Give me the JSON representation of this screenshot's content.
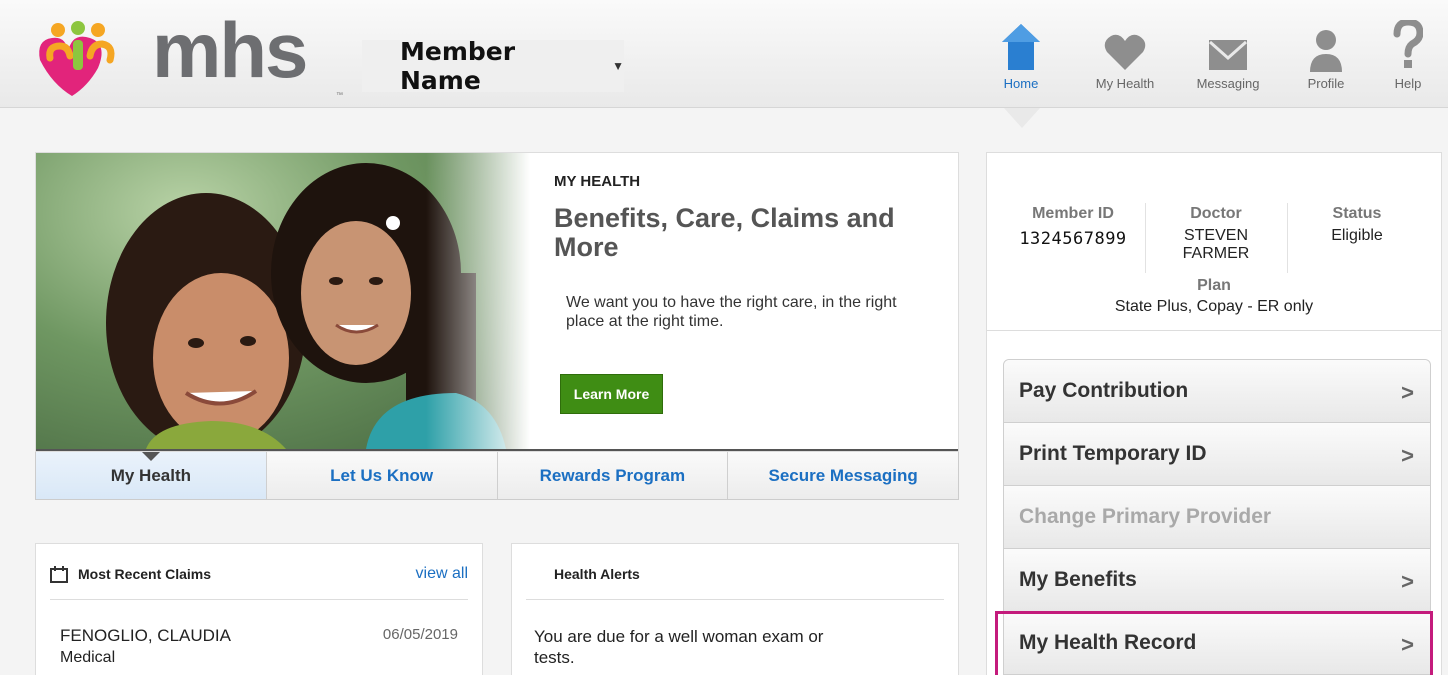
{
  "header": {
    "logo_text": "mhs",
    "member_name": "Member Name",
    "nav": [
      {
        "label": "Home",
        "icon": "home-icon"
      },
      {
        "label": "My Health",
        "icon": "heart-icon"
      },
      {
        "label": "Messaging",
        "icon": "envelope-icon"
      },
      {
        "label": "Profile",
        "icon": "person-icon"
      },
      {
        "label": "Help",
        "icon": "question-icon"
      }
    ]
  },
  "hero": {
    "eyebrow": "MY HEALTH",
    "title": "Benefits, Care, Claims and More",
    "body": "We want you to have the right care, in the right place at the right time.",
    "button": "Learn More"
  },
  "tabs": [
    "My Health",
    "Let Us Know",
    "Rewards Program",
    "Secure Messaging"
  ],
  "claims": {
    "title": "Most Recent Claims",
    "view_all": "view all",
    "items": [
      {
        "name": "FENOGLIO, CLAUDIA",
        "type": "Medical",
        "date": "06/05/2019"
      }
    ]
  },
  "alerts": {
    "title": "Health Alerts",
    "text": "You are due for a well woman exam or tests."
  },
  "member_info": {
    "member_id_label": "Member ID",
    "member_id": "1324567899",
    "doctor_label": "Doctor",
    "doctor_first": "STEVEN",
    "doctor_last": "FARMER",
    "status_label": "Status",
    "status": "Eligible",
    "plan_label": "Plan",
    "plan": "State Plus, Copay - ER only"
  },
  "actions": [
    {
      "label": "Pay Contribution",
      "enabled": true
    },
    {
      "label": "Print Temporary ID",
      "enabled": true
    },
    {
      "label": "Change Primary Provider",
      "enabled": false
    },
    {
      "label": "My Benefits",
      "enabled": true
    },
    {
      "label": "My Health Record",
      "enabled": true
    }
  ],
  "colors": {
    "accent_blue": "#1b6fc2",
    "button_green": "#3f8d14",
    "highlight_magenta": "#c41b7c",
    "logo_gray": "#6d6e71"
  }
}
